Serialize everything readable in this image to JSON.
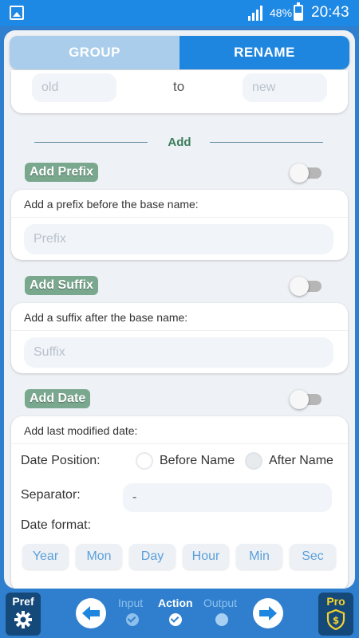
{
  "status_bar": {
    "battery": "48%",
    "time": "20:43"
  },
  "tabs": {
    "group": "GROUP",
    "rename": "RENAME"
  },
  "replace": {
    "old_placeholder": "old",
    "to_label": "to",
    "new_placeholder": "new"
  },
  "section": {
    "title": "Add"
  },
  "prefix": {
    "badge": "Add Prefix",
    "description": "Add a prefix before the base name:",
    "placeholder": "Prefix",
    "enabled": false
  },
  "suffix": {
    "badge": "Add Suffix",
    "description": "Add a suffix after the base name:",
    "placeholder": "Suffix",
    "enabled": false
  },
  "date": {
    "badge": "Add Date",
    "enabled": false,
    "description": "Add last modified date:",
    "position_label": "Date Position:",
    "option_before": "Before Name",
    "option_after": "After Name",
    "selected": "After Name",
    "separator_label": "Separator:",
    "separator_value": "-",
    "format_label": "Date format:",
    "format_buttons": [
      "Year",
      "Mon",
      "Day",
      "Hour",
      "Min",
      "Sec"
    ]
  },
  "bottom_bar": {
    "pref_label": "Pref",
    "pro_label": "Pro",
    "steps": [
      {
        "label": "Input",
        "state": "done"
      },
      {
        "label": "Action",
        "state": "active"
      },
      {
        "label": "Output",
        "state": "pending"
      }
    ]
  },
  "colors": {
    "accent": "#1f86e0",
    "badge": "#7aa88f",
    "section": "#3b7d5c"
  }
}
